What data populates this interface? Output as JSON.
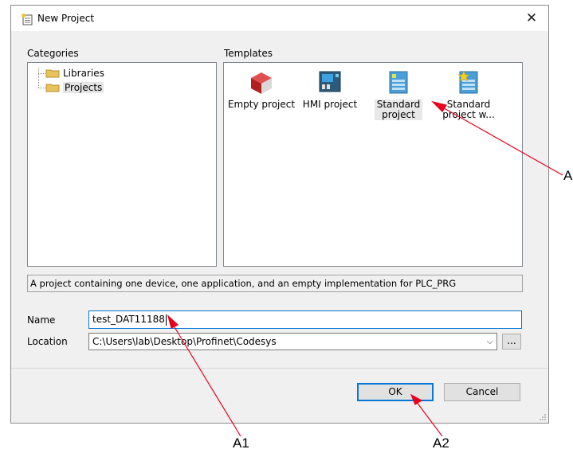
{
  "window": {
    "title": "New Project",
    "close_glyph": "✕"
  },
  "categories": {
    "label": "Categories",
    "items": [
      {
        "label": "Libraries",
        "icon": "folder-icon",
        "selected": false
      },
      {
        "label": "Projects",
        "icon": "folder-icon",
        "selected": true
      }
    ]
  },
  "templates": {
    "label": "Templates",
    "items": [
      {
        "label": "Empty project",
        "icon": "empty-project-icon",
        "selected": false
      },
      {
        "label": "HMI project",
        "icon": "hmi-project-icon",
        "selected": false
      },
      {
        "label_line1": "Standard",
        "label_line2": "project",
        "icon": "standard-project-icon",
        "selected": true
      },
      {
        "label_line1": "Standard",
        "label_line2": "project w...",
        "icon": "standard-project-wizard-icon",
        "selected": false
      }
    ]
  },
  "description": "A project containing one device, one application, and an empty implementation for PLC_PRG",
  "form": {
    "name_label": "Name",
    "name_value": "test_DAT11188",
    "location_label": "Location",
    "location_value": "C:\\Users\\lab\\Desktop\\Profinet\\Codesys",
    "dropdown_glyph": "⌵",
    "browse_label": "..."
  },
  "buttons": {
    "ok": "OK",
    "cancel": "Cancel"
  },
  "annotations": {
    "a": "A",
    "a1": "A1",
    "a2": "A2",
    "color": "#e8001c"
  }
}
